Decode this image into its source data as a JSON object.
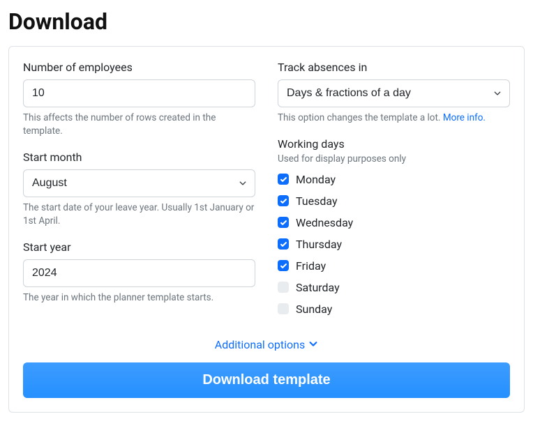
{
  "page_title": "Download",
  "left": {
    "employees": {
      "label": "Number of employees",
      "value": "10",
      "help": "This affects the number of rows created in the template."
    },
    "start_month": {
      "label": "Start month",
      "value": "August",
      "help": "The start date of your leave year. Usually 1st January or 1st April."
    },
    "start_year": {
      "label": "Start year",
      "value": "2024",
      "help": "The year in which the planner template starts."
    }
  },
  "right": {
    "track": {
      "label": "Track absences in",
      "value": "Days & fractions of a day",
      "help": "This option changes the template a lot. ",
      "more_info": "More info."
    },
    "working_days": {
      "label": "Working days",
      "sub": "Used for display purposes only",
      "days": [
        {
          "name": "Monday",
          "checked": true
        },
        {
          "name": "Tuesday",
          "checked": true
        },
        {
          "name": "Wednesday",
          "checked": true
        },
        {
          "name": "Thursday",
          "checked": true
        },
        {
          "name": "Friday",
          "checked": true
        },
        {
          "name": "Saturday",
          "checked": false
        },
        {
          "name": "Sunday",
          "checked": false
        }
      ]
    }
  },
  "additional_label": "Additional options",
  "download_label": "Download template"
}
